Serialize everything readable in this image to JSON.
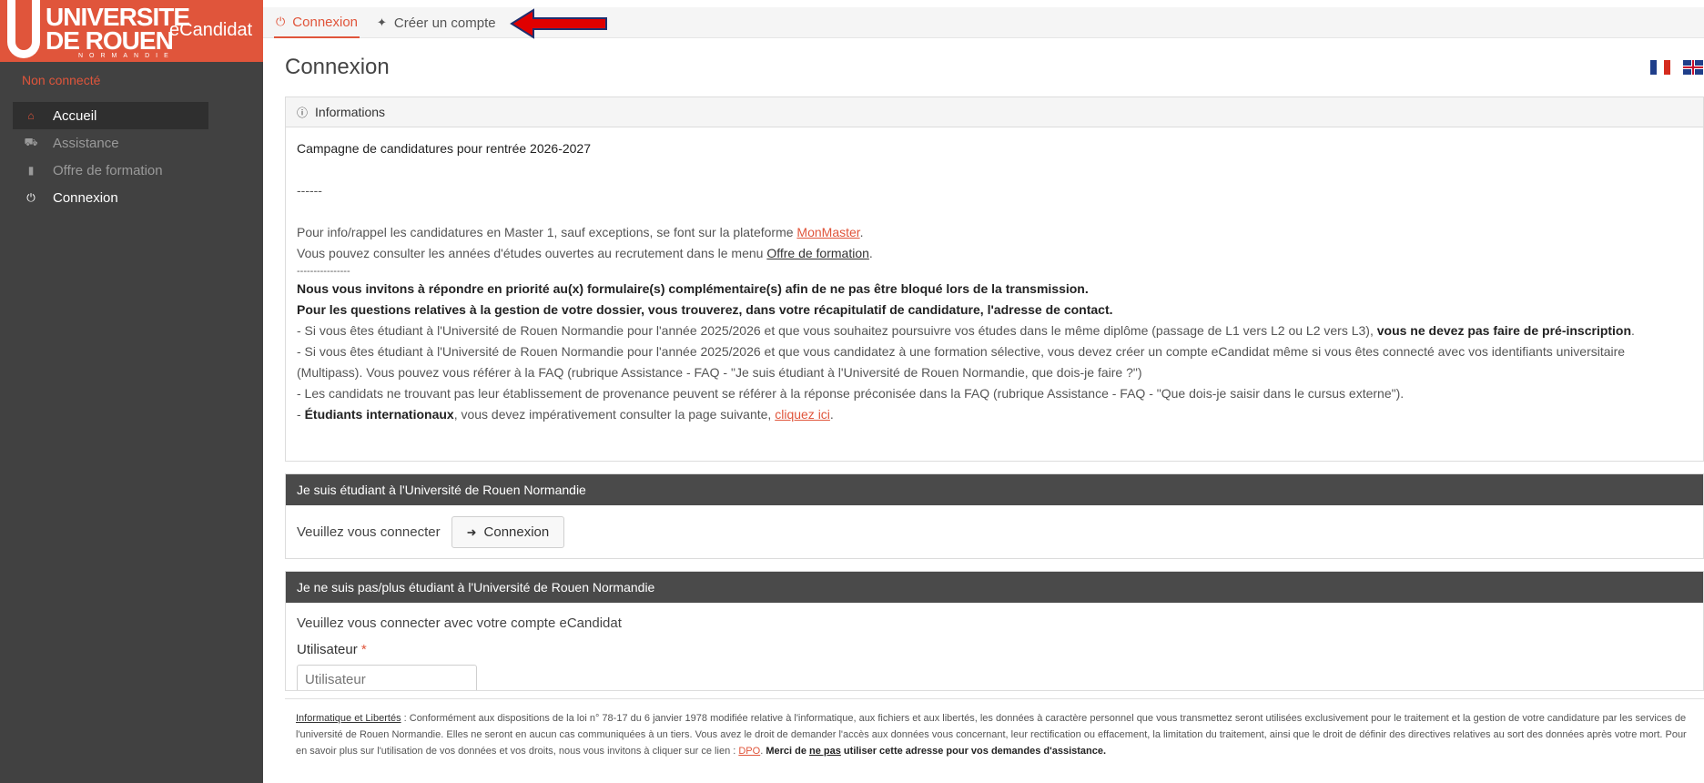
{
  "sidebar": {
    "logo": {
      "line1": "UNIVERSITE",
      "line2": "DE ROUEN",
      "line3": "NORMANDIE",
      "app": "eCandidat"
    },
    "status": "Non connecté",
    "items": [
      {
        "label": "Accueil",
        "icon": "home-icon"
      },
      {
        "label": "Assistance",
        "icon": "ambulance-icon"
      },
      {
        "label": "Offre de formation",
        "icon": "bookmark-icon"
      },
      {
        "label": "Connexion",
        "icon": "power-icon"
      }
    ]
  },
  "topbar": {
    "tabs": [
      {
        "label": "Connexion",
        "icon": "power-icon"
      },
      {
        "label": "Créer un compte",
        "icon": "magic-wand-icon"
      }
    ]
  },
  "page": {
    "title": "Connexion"
  },
  "info": {
    "heading": "Informations",
    "campaign": "Campagne de candidatures pour rentrée 2026-2027",
    "sep1": "------",
    "p1a": "Pour info/rappel les candidatures en Master 1, sauf exceptions, se font sur la plateforme ",
    "p1link": "MonMaster",
    "p1b": ".",
    "p2a": "Vous pouvez consulter les années d'études ouvertes au recrutement dans le menu ",
    "p2link": "Offre de formation",
    "p2b": ".",
    "sep2": "----------------",
    "bold1": "Nous vous invitons à répondre en priorité au(x) formulaire(s) complémentaire(s) afin de ne pas être bloqué lors de la transmission.",
    "bold2": "Pour les questions relatives à la gestion de votre dossier, vous trouverez, dans votre récapitulatif de candidature, l'adresse de contact.",
    "p3a": "- Si vous êtes étudiant à l'Université de Rouen Normandie pour l'année 2025/2026 et que vous souhaitez poursuivre vos études dans le même diplôme (passage de L1 vers L2 ou L2 vers L3), ",
    "p3bold": "vous ne devez pas faire de pré-inscription",
    "p3b": ".",
    "p4": "- Si vous êtes étudiant à l'Université de Rouen Normandie pour l'année 2025/2026 et que vous candidatez à une formation sélective, vous devez créer un compte eCandidat même si vous êtes connecté avec vos identifiants universitaire (Multipass). Vous pouvez vous référer à la FAQ (rubrique Assistance - FAQ - \"Je suis étudiant à l'Université de Rouen Normandie, que dois-je faire ?\")",
    "p5": "- Les candidats ne trouvant pas leur établissement de provenance peuvent se référer à la réponse préconisée dans la FAQ (rubrique Assistance - FAQ - \"Que dois-je saisir dans le cursus externe\").",
    "p6a": "- ",
    "p6bold": "Étudiants internationaux",
    "p6b": ", vous devez impérativement consulter la page suivante, ",
    "p6link": "cliquez ici",
    "p6c": "."
  },
  "student": {
    "heading": "Je suis étudiant à l'Université de Rouen Normandie",
    "prompt": "Veuillez vous connecter",
    "button": "Connexion"
  },
  "nonstudent": {
    "heading": "Je ne suis pas/plus étudiant à l'Université de Rouen Normandie",
    "prompt": "Veuillez vous connecter avec votre compte eCandidat",
    "user_label": "Utilisateur",
    "required": "*",
    "user_placeholder": "Utilisateur"
  },
  "footer": {
    "link1": "Informatique et Libertés",
    "text1": " : Conformément aux dispositions de la loi n° 78-17 du 6 janvier 1978 modifiée relative à l'informatique, aux fichiers et aux libertés, les données à caractère personnel que vous transmettez seront utilisées exclusivement pour le traitement et la gestion de votre candidature par les services de l'université de Rouen Normandie. Elles ne seront en aucun cas communiquées à un tiers. Vous avez le droit de demander l'accès aux données vous concernant, leur rectification ou effacement, la limitation du traitement, ainsi que le droit de définir des directives relatives au sort des données après votre mort. Pour en savoir plus sur l'utilisation de vos données et vos droits, nous vous invitons à cliquer sur ce lien : ",
    "link2": "DPO",
    "text2": ". ",
    "bold1": "Merci de ",
    "bold_u": "ne pas",
    "bold2": " utiliser cette adresse pour vos demandes d'assistance."
  },
  "colors": {
    "accent": "#e0553b",
    "sidebar": "#414141",
    "arrow": "#e00000"
  }
}
